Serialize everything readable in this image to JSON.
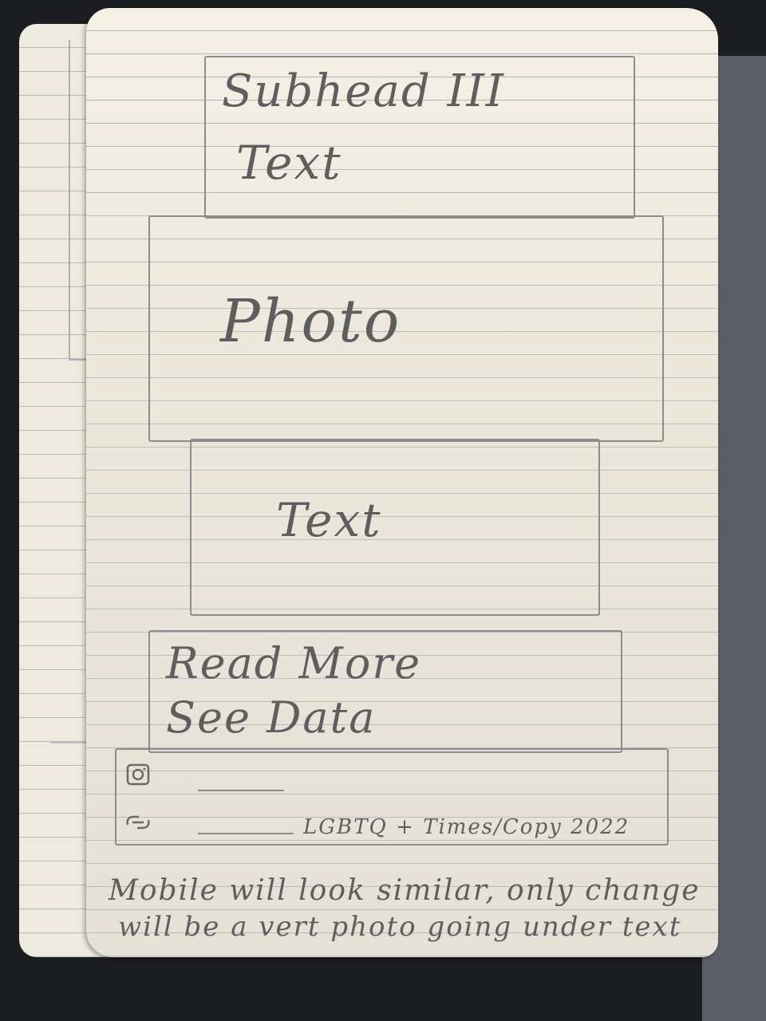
{
  "sketch": {
    "subhead": "Subhead III",
    "subhead_text": "Text",
    "photo": "Photo",
    "text": "Text",
    "read_more": "Read More",
    "see_data": "See Data",
    "footer_copy": "LGBTQ + Times/Copy 2022",
    "note_line1": "Mobile will look similar, only change",
    "note_line2": "will be a vert photo going under text"
  },
  "icons": {
    "footer_icon_1": "instagram-icon",
    "footer_icon_2": "link-icon"
  },
  "colors": {
    "paper": "#f4f0e6",
    "pencil": "#5e5e5e",
    "ruling": "#aeb2bd",
    "background": "#1c1d21"
  }
}
